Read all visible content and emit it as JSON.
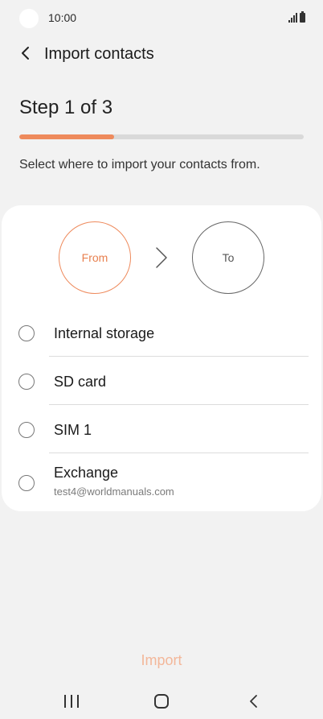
{
  "status_bar": {
    "time": "10:00"
  },
  "header": {
    "title": "Import contacts"
  },
  "step": {
    "title": "Step 1 of 3",
    "progress": 0.333
  },
  "instructions": "Select where to import your contacts from.",
  "flow": {
    "from_label": "From",
    "to_label": "To"
  },
  "options": [
    {
      "label": "Internal storage"
    },
    {
      "label": "SD card"
    },
    {
      "label": "SIM 1"
    },
    {
      "label": "Exchange",
      "sublabel": "test4@worldmanuals.com"
    }
  ],
  "import_button": {
    "label": "Import"
  },
  "colors": {
    "accent": "#ee8a5c",
    "disabled_accent": "#f3b79a",
    "background": "#f2f2f2"
  }
}
